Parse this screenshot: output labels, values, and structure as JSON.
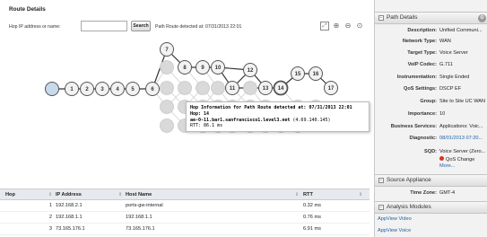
{
  "page": {
    "title": "Route Details",
    "hop_label": "Hop IP address or name:",
    "hop_input_value": "",
    "search_label": "Search",
    "detected_text": "Path Route detected at: 07/31/2013 22:01"
  },
  "toolbar": {
    "icons": [
      "fit-to-view-icon",
      "zoom-in-icon",
      "zoom-out-icon",
      "zoom-reset-icon"
    ]
  },
  "graph": {
    "nodes": [
      "1",
      "2",
      "3",
      "4",
      "5",
      "6",
      "7",
      "8",
      "9",
      "10",
      "11",
      "12",
      "13",
      "14",
      "15",
      "16",
      "17"
    ]
  },
  "tooltip": {
    "title": "Hop Information for Path Route detected at: 07/31/2013 22:01",
    "hop": "Hop: 14",
    "host": "ae-0-11.bar1.sanfrancisco1.level3.net",
    "host_ip": "(4.69.140.145)",
    "rtt": "RTT: 86.1 ms"
  },
  "table": {
    "columns": [
      "Hop",
      "IP Address",
      "Host Name",
      "RTT"
    ],
    "rows": [
      {
        "hop": "1",
        "ip": "192.168.2.1",
        "host": "ports-gw-internal",
        "rtt": "0.32 ms"
      },
      {
        "hop": "2",
        "ip": "192.168.1.1",
        "host": "192.168.1.1",
        "rtt": "0.76 ms"
      },
      {
        "hop": "3",
        "ip": "73.165.176.1",
        "host": "73.165.176.1",
        "rtt": "6.91 ms"
      }
    ]
  },
  "path_details": {
    "title": "Path Details",
    "rows": [
      {
        "k": "Description:",
        "v": "Unified Communi..."
      },
      {
        "k": "Network Type:",
        "v": "WAN"
      },
      {
        "k": "Target Type:",
        "v": "Voice Server"
      },
      {
        "k": "VoIP Codec:",
        "v": "G.711"
      },
      {
        "k": "Instrumentation:",
        "v": "Single Ended"
      },
      {
        "k": "QoS Settings:",
        "v": "DSCP EF"
      },
      {
        "k": "Group:",
        "v": "Site to Site UC WAN"
      },
      {
        "k": "Importance:",
        "v": "10"
      },
      {
        "k": "Business Services:",
        "v": "Applications: Voic..."
      },
      {
        "k": "Diagnostic:",
        "v": "08/01/2013 07:20..."
      }
    ],
    "sqd_label": "SQD:",
    "sqd_value": "Voice Server (Zero...",
    "qos_change": "QoS Change",
    "more": "More..."
  },
  "source_appliance": {
    "title": "Source Appliance",
    "timezone_label": "Time Zone:",
    "timezone_value": "GMT-4"
  },
  "analysis_modules": {
    "title": "Analysis Modules",
    "links": [
      "AppView Video",
      "AppView Voice"
    ]
  },
  "colors": {
    "active_node": "#f2f2f2",
    "inactive_node": "#d9d9d9",
    "source_node": "#c7d9ea",
    "link": "#1f5fa8",
    "error": "#d9331c"
  }
}
